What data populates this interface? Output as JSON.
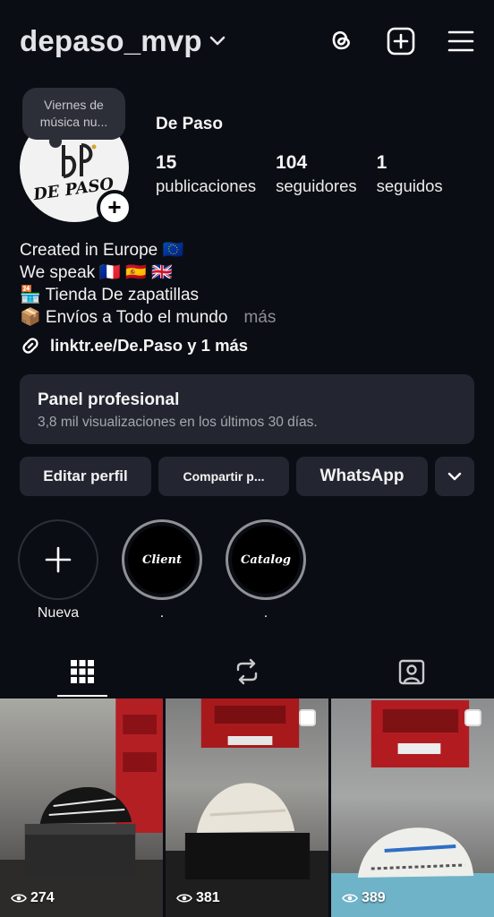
{
  "header": {
    "username": "depaso_mvp",
    "icons": [
      "chevron-down-icon",
      "threads-icon",
      "new-post-icon",
      "menu-icon"
    ]
  },
  "profile": {
    "note": "Viernes de música nu...",
    "display_name": "De Paso",
    "avatar_logo_text": "DE PASO",
    "stats": [
      {
        "value": "15",
        "label": "publicaciones"
      },
      {
        "value": "104",
        "label": "seguidores"
      },
      {
        "value": "1",
        "label": "seguidos"
      }
    ]
  },
  "bio": {
    "line1": "Created in Europe 🇪🇺",
    "line2": "We speak 🇫🇷 🇪🇸 🇬🇧",
    "line3": "🏪 Tienda De zapatillas",
    "line4": "📦 Envíos a Todo el mundo",
    "more": "más",
    "link": "linktr.ee/De.Paso y 1 más"
  },
  "pro_panel": {
    "title": "Panel profesional",
    "subtitle": "3,8 mil visualizaciones en los últimos 30 días."
  },
  "buttons": {
    "edit": "Editar perfil",
    "share": "Compartir p...",
    "whatsapp": "WhatsApp"
  },
  "highlights": [
    {
      "label": "Nueva",
      "cover": ""
    },
    {
      "label": ".",
      "cover": "Client"
    },
    {
      "label": ".",
      "cover": "Catalog"
    }
  ],
  "tabs": [
    "grid-icon",
    "reels-repost-icon",
    "tagged-icon"
  ],
  "posts": [
    {
      "views": "274"
    },
    {
      "views": "381"
    },
    {
      "views": "389"
    }
  ],
  "colors": {
    "background": "#0b0d14",
    "card": "#232630",
    "muted_text": "#8e8e93"
  }
}
